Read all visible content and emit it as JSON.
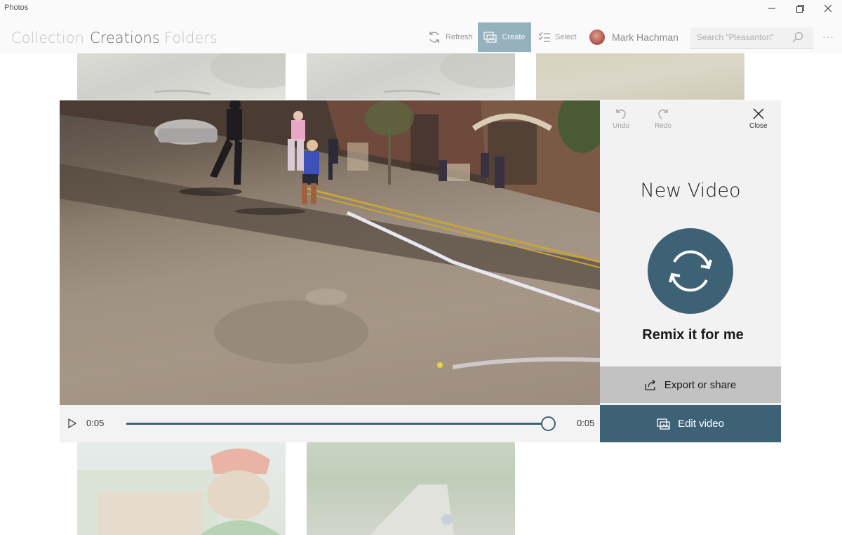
{
  "window": {
    "title": "Photos"
  },
  "nav": {
    "tabs": [
      {
        "label": "Collection",
        "active": false
      },
      {
        "label": "Creations",
        "active": true
      },
      {
        "label": "Folders",
        "active": false
      }
    ]
  },
  "toolbar": {
    "refresh_label": "Refresh",
    "create_label": "Create",
    "select_label": "Select",
    "user_name": "Mark Hachman",
    "search_placeholder": "Search \"Pleasanton\"",
    "more_label": "···"
  },
  "player": {
    "current_time": "0:05",
    "duration": "0:05",
    "progress": 1.0
  },
  "side_panel": {
    "undo_label": "Undo",
    "redo_label": "Redo",
    "close_label": "Close",
    "title": "New Video",
    "remix_label": "Remix it for me",
    "export_label": "Export or share",
    "edit_label": "Edit video"
  },
  "colors": {
    "accent": "#3d6276",
    "create_highlight": "#95b1bd",
    "export_bg": "#c2c2c2",
    "panel_bg": "#f2f2f2"
  }
}
